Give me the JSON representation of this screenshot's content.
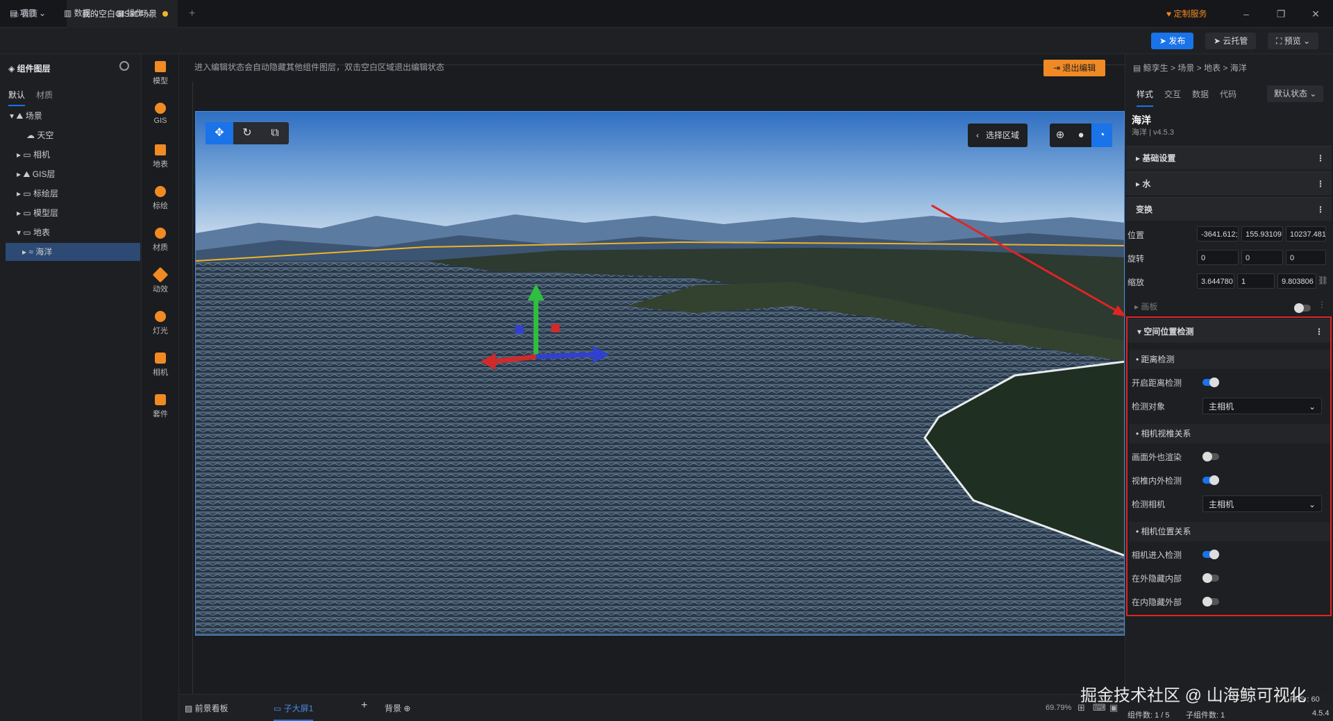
{
  "titlebar": {
    "home_tab": "首页",
    "scene_tab": "我的空白GIS3D场景",
    "custom_service": "定制服务",
    "win_min": "–",
    "win_max": "❐",
    "win_close": "✕"
  },
  "menubar": {
    "project": "项目",
    "data": "数据",
    "operate": "操作",
    "publish": "发布",
    "cloud": "云托管",
    "preview": "预览"
  },
  "leftpanel": {
    "title": "组件图层",
    "tab_default": "默认",
    "tab_material": "材质",
    "tree": [
      {
        "label": "场景",
        "indent": 0
      },
      {
        "label": "天空",
        "indent": 1
      },
      {
        "label": "相机",
        "indent": 1
      },
      {
        "label": "GIS层",
        "indent": 1
      },
      {
        "label": "标绘层",
        "indent": 1
      },
      {
        "label": "模型层",
        "indent": 1
      },
      {
        "label": "地表",
        "indent": 1
      },
      {
        "label": "海洋",
        "indent": 2
      }
    ]
  },
  "iconbar": [
    "模型",
    "GIS",
    "地表",
    "标绘",
    "材质",
    "动效",
    "灯光",
    "相机",
    "套件"
  ],
  "canvas": {
    "hint": "进入编辑状态会自动隐藏其他组件图层，双击空白区域退出编辑状态",
    "exit_edit": "退出编辑",
    "select_area": "选择区域"
  },
  "bottombar": {
    "foreground": "前景看板",
    "sub_screen": "子大屏1",
    "add": "+",
    "background": "背景",
    "zoom": "69.79%"
  },
  "status": {
    "line1": "FPS : 60",
    "components": "组件数: 1 / 5",
    "sub_components": "子组件数: 1",
    "version": "4.5.4"
  },
  "rightpanel": {
    "breadcrumb": "鲸孪生 > 场景 > 地表 > 海洋",
    "tabs": [
      "样式",
      "交互",
      "数据",
      "代码"
    ],
    "state": "默认状态",
    "comp_name": "海洋",
    "comp_ver": "海洋 | v4.5.3",
    "sections": {
      "basic": "基础设置",
      "water": "水",
      "transform": "变换",
      "panel": "画板",
      "spatial": "空间位置检测"
    },
    "transform": {
      "position_label": "位置",
      "position": [
        "-3641.612;",
        "155.93109",
        "10237.481"
      ],
      "rotation_label": "旋转",
      "rotation": [
        "0",
        "0",
        "0"
      ],
      "scale_label": "缩放",
      "scale": [
        "3.644780",
        "1",
        "9.803806"
      ]
    },
    "distance": {
      "title": "距离检测",
      "enable_label": "开启距离检测",
      "enable": true,
      "target_label": "检测对象",
      "target": "主相机"
    },
    "frustum": {
      "title": "相机视椎关系",
      "render_outside_label": "画面外也渲染",
      "render_outside": false,
      "inside_check_label": "视椎内外检测",
      "inside_check": true,
      "camera_label": "检测相机",
      "camera": "主相机"
    },
    "position_rel": {
      "title": "相机位置关系",
      "enter_label": "相机进入检测",
      "enter": true,
      "hide_inside_label": "在外隐藏内部",
      "hide_inside": false,
      "hide_outside_label": "在内隐藏外部",
      "hide_outside": false
    }
  },
  "watermark": "掘金技术社区 @ 山海鲸可视化"
}
